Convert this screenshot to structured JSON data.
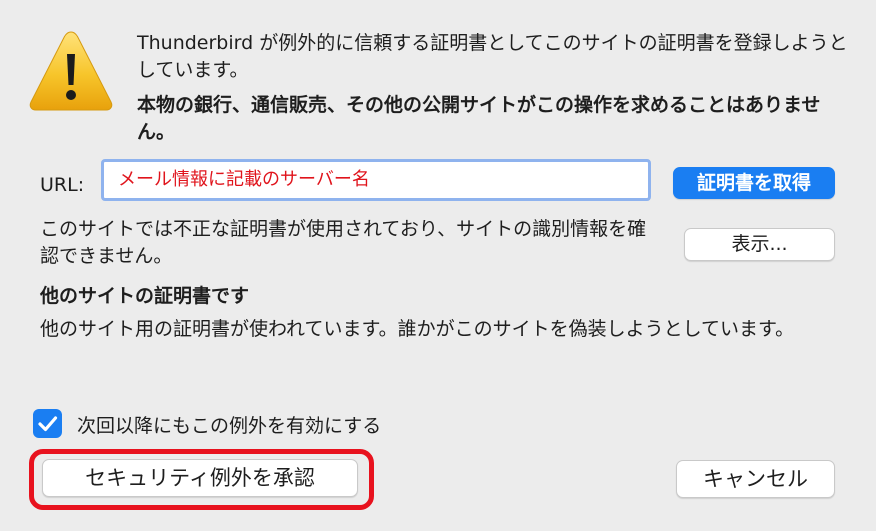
{
  "dialog": {
    "intro_text": "Thunderbird が例外的に信頼する証明書としてこのサイトの証明書を登録しようとしています。",
    "warning_text": "本物の銀行、通信販売、その他の公開サイトがこの操作を求めることはありません。",
    "warning_icon": "warning-triangle-icon",
    "url_label": "URL:",
    "url_value": "メール情報に記載のサーバー名",
    "get_cert_button": "証明書を取得",
    "status_text": "このサイトでは不正な証明書が使用されており、サイトの識別情報を確認できません。",
    "view_button": "表示...",
    "problem_heading": "他のサイトの証明書です",
    "problem_text": "他のサイト用の証明書が使われています。誰かがこのサイトを偽装しようとしています。",
    "permanent_checkbox": {
      "label": "次回以降にもこの例外を有効にする",
      "checked": true
    },
    "confirm_button": "セキュリティ例外を承認",
    "cancel_button": "キャンセル"
  },
  "colors": {
    "accent": "#1a7ef2",
    "url_text": "#e0141c",
    "highlight_outline": "#e8121e",
    "background": "#ececec"
  }
}
